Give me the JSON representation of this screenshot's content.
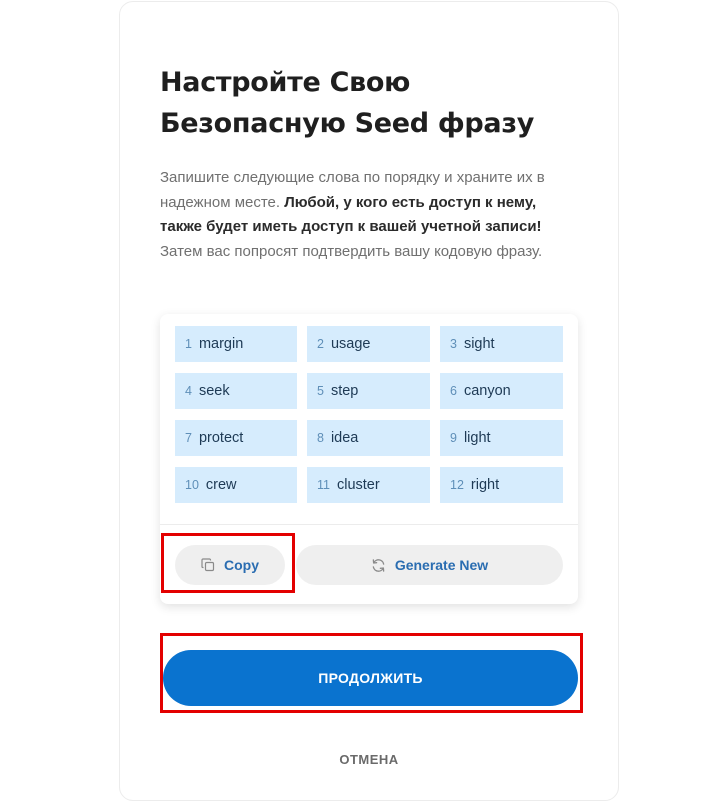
{
  "header": {
    "title_line1": "Настройте Свою",
    "title_line2": "Безопасную Seed фразу"
  },
  "description": {
    "part1": "Запишите следующие слова по порядку и храните их в надежном месте. ",
    "bold": "Любой, у кого есть доступ к нему, также будет иметь доступ к вашей учетной записи!",
    "part2": " Затем вас попросят подтвердить вашу кодовую фразу."
  },
  "seed_words": [
    {
      "num": "1",
      "word": "margin"
    },
    {
      "num": "2",
      "word": "usage"
    },
    {
      "num": "3",
      "word": "sight"
    },
    {
      "num": "4",
      "word": "seek"
    },
    {
      "num": "5",
      "word": "step"
    },
    {
      "num": "6",
      "word": "canyon"
    },
    {
      "num": "7",
      "word": "protect"
    },
    {
      "num": "8",
      "word": "idea"
    },
    {
      "num": "9",
      "word": "light"
    },
    {
      "num": "10",
      "word": "crew"
    },
    {
      "num": "11",
      "word": "cluster"
    },
    {
      "num": "12",
      "word": "right"
    }
  ],
  "actions": {
    "copy_label": "Copy",
    "generate_label": "Generate New",
    "continue_label": "ПРОДОЛЖИТЬ",
    "cancel_label": "ОТМЕНА"
  },
  "icons": {
    "copy": "copy-icon",
    "generate": "refresh-icon"
  },
  "colors": {
    "primary": "#0a73cf",
    "word_bg": "#d6ecfd",
    "highlight": "#e30000",
    "link_text": "#2a6db1"
  }
}
